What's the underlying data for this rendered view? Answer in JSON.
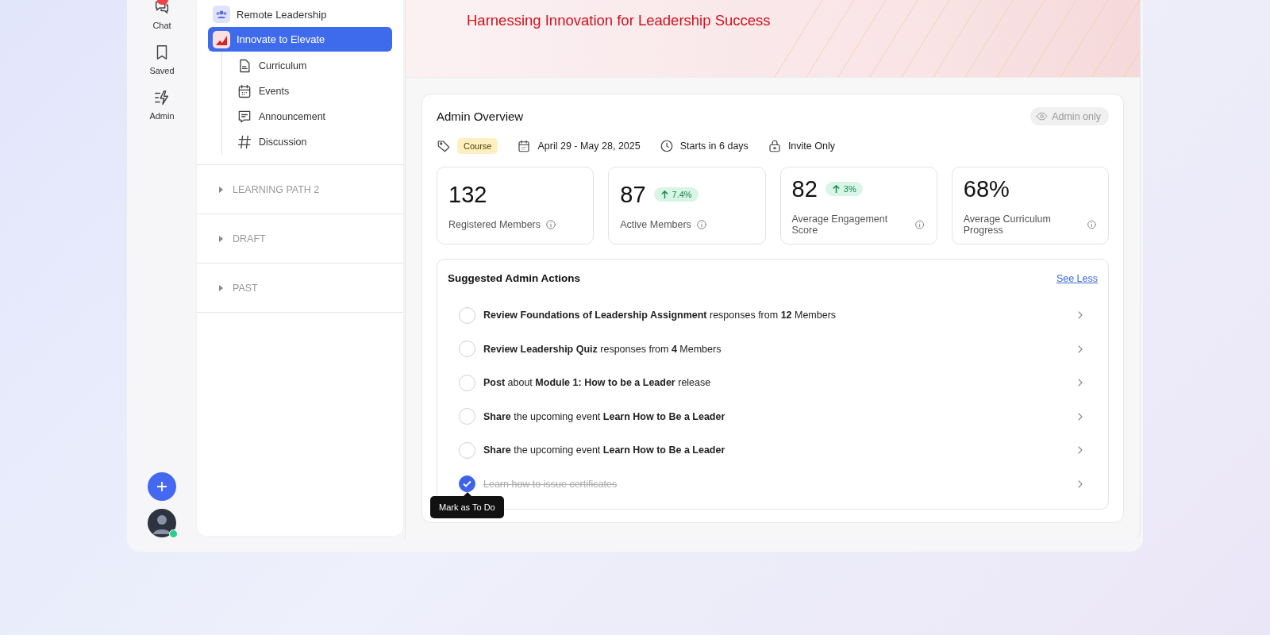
{
  "rail": {
    "items": [
      {
        "label": "Chat",
        "kind": "chat",
        "badge": true
      },
      {
        "label": "Saved",
        "kind": "bookmark",
        "badge": false
      },
      {
        "label": "Admin",
        "kind": "admin",
        "badge": false
      }
    ],
    "user": {
      "online": true
    }
  },
  "sidebar": {
    "courses": [
      {
        "label": "Remote Leadership",
        "kind": "people",
        "selected": false
      },
      {
        "label": "Innovate to Elevate",
        "kind": "chart",
        "selected": true,
        "children": [
          {
            "label": "Curriculum",
            "kind": "doc"
          },
          {
            "label": "Events",
            "kind": "calendar"
          },
          {
            "label": "Announcement",
            "kind": "message"
          },
          {
            "label": "Discussion",
            "kind": "hash"
          }
        ]
      }
    ],
    "groups": [
      {
        "label": "LEARNING PATH 2",
        "expanded": false
      },
      {
        "label": "DRAFT",
        "expanded": false
      },
      {
        "label": "PAST",
        "expanded": false
      }
    ]
  },
  "banner": {
    "title": "Harnessing Innovation for Leadership Success"
  },
  "overview": {
    "title": "Admin Overview",
    "visibility": "Admin only",
    "meta": [
      {
        "kind": "tag",
        "label": "Course"
      },
      {
        "kind": "calendar",
        "label": "April 29 - May 28, 2025"
      },
      {
        "kind": "clock",
        "label": "Starts in 6 days"
      },
      {
        "kind": "lock",
        "label": "Invite Only"
      }
    ],
    "stats": [
      {
        "value": "132",
        "label": "Registered Members"
      },
      {
        "value": "87",
        "change": "7.4%",
        "label": "Active Members"
      },
      {
        "value": "82",
        "change": "3%",
        "label": "Average Engagement Score"
      },
      {
        "value": "68%",
        "label": "Average Curriculum Progress"
      }
    ]
  },
  "actions": {
    "title": "Suggested Admin Actions",
    "link": "See Less",
    "items": [
      {
        "text": "**Review Foundations of Leadership Assignment** responses from **12** Members",
        "checked": false
      },
      {
        "text": "**Review Leadership Quiz** responses from **4** Members",
        "checked": false
      },
      {
        "text": "**Post** about **Module 1: How to be a Leader** release",
        "checked": false
      },
      {
        "text": "**Share** the upcoming event **Learn How to Be a Leader**",
        "checked": false
      },
      {
        "text": "**Share** the upcoming event **Learn How to Be a Leader**",
        "checked": false
      },
      {
        "text": "Learn how to issue certificates",
        "checked": true,
        "tooltip": "Mark as To Do"
      }
    ]
  }
}
